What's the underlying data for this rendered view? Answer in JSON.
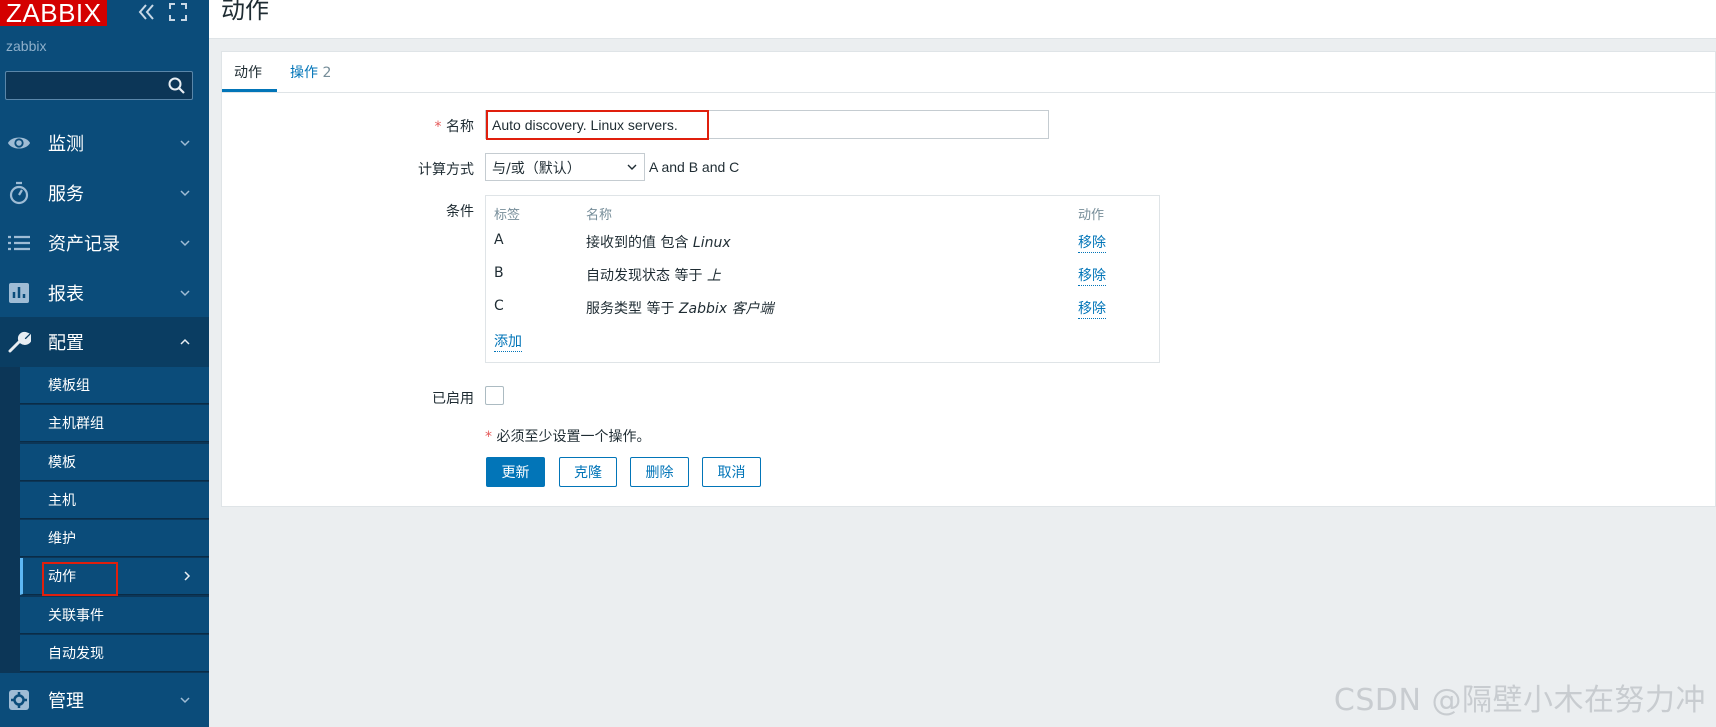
{
  "app": {
    "logo": "ZABBIX",
    "user": "zabbix"
  },
  "sidebar": {
    "search": {
      "value": "",
      "placeholder": ""
    },
    "menu": [
      {
        "label": "监测",
        "icon": "eye-icon"
      },
      {
        "label": "服务",
        "icon": "stopwatch-icon"
      },
      {
        "label": "资产记录",
        "icon": "list-icon"
      },
      {
        "label": "报表",
        "icon": "bar-chart-icon"
      },
      {
        "label": "配置",
        "icon": "wrench-icon"
      },
      {
        "label": "管理",
        "icon": "gear-icon"
      }
    ],
    "submenu": [
      "模板组",
      "主机群组",
      "模板",
      "主机",
      "维护",
      "动作",
      "关联事件",
      "自动发现"
    ],
    "active_submenu": "动作"
  },
  "page": {
    "title": "动作"
  },
  "tabs": {
    "action": "动作",
    "operations": "操作",
    "operations_count": "2"
  },
  "form": {
    "name_label": "名称",
    "name_value": "Auto discovery. Linux servers.",
    "calc_label": "计算方式",
    "calc_value": "与/或（默认）",
    "calc_formula": "A and B and C",
    "conditions_label": "条件",
    "conditions_headers": {
      "label": "标签",
      "name": "名称",
      "action": "动作"
    },
    "conditions": [
      {
        "label": "A",
        "prefix": "接收到的值 包含 ",
        "value": "Linux",
        "action": "移除"
      },
      {
        "label": "B",
        "prefix": "自动发现状态 等于 ",
        "value": "上",
        "action": "移除"
      },
      {
        "label": "C",
        "prefix": "服务类型 等于 ",
        "value": "Zabbix 客户端",
        "action": "移除"
      }
    ],
    "add_label": "添加",
    "enabled_label": "已启用",
    "enabled": false,
    "required_note": "必须至少设置一个操作。"
  },
  "buttons": {
    "update": "更新",
    "clone": "克隆",
    "delete": "删除",
    "cancel": "取消"
  },
  "watermark": "CSDN @隔壁小木在努力冲",
  "colors": {
    "sidebar": "#0b4c7a",
    "accent": "#0275b8",
    "logo": "#d40000",
    "highlight": "#e01f0d"
  }
}
